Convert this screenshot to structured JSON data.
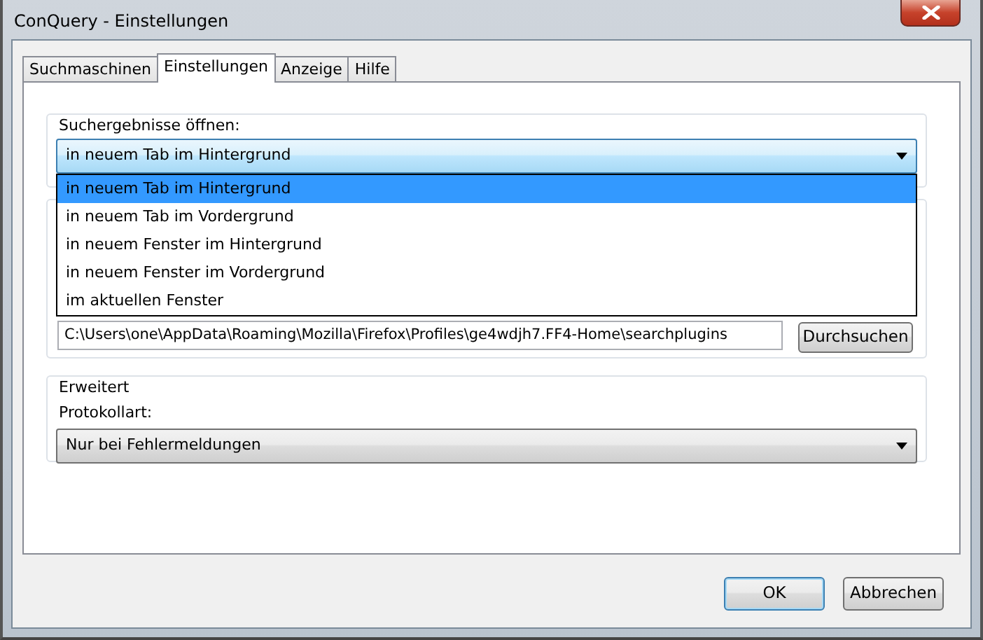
{
  "window": {
    "title": "ConQuery - Einstellungen"
  },
  "tabs": [
    {
      "label": "Suchmaschinen",
      "selected": false
    },
    {
      "label": "Einstellungen",
      "selected": true
    },
    {
      "label": "Anzeige",
      "selected": false
    },
    {
      "label": "Hilfe",
      "selected": false
    }
  ],
  "results_group": {
    "title": "Suchergebnisse öffnen:",
    "dropdown": {
      "value": "in neuem Tab im Hintergrund",
      "expanded": true,
      "options": [
        {
          "label": "in neuem Tab im Hintergrund",
          "selected": true
        },
        {
          "label": "in neuem Tab im Vordergrund",
          "selected": false
        },
        {
          "label": "in neuem Fenster im Hintergrund",
          "selected": false
        },
        {
          "label": "in neuem Fenster im Vordergrund",
          "selected": false
        },
        {
          "label": "im aktuellen Fenster",
          "selected": false
        }
      ]
    }
  },
  "plugins_group": {
    "path": "C:\\Users\\one\\AppData\\Roaming\\Mozilla\\Firefox\\Profiles\\ge4wdjh7.FF4-Home\\searchplugins",
    "button": "Durchsuchen"
  },
  "advanced_group": {
    "title": "Erweitert",
    "label": "Protokollart:",
    "dropdown": {
      "value": "Nur bei Fehlermeldungen",
      "expanded": false
    }
  },
  "buttons": [
    {
      "label": "OK",
      "default": true
    },
    {
      "label": "Abbrechen",
      "default": false
    }
  ]
}
